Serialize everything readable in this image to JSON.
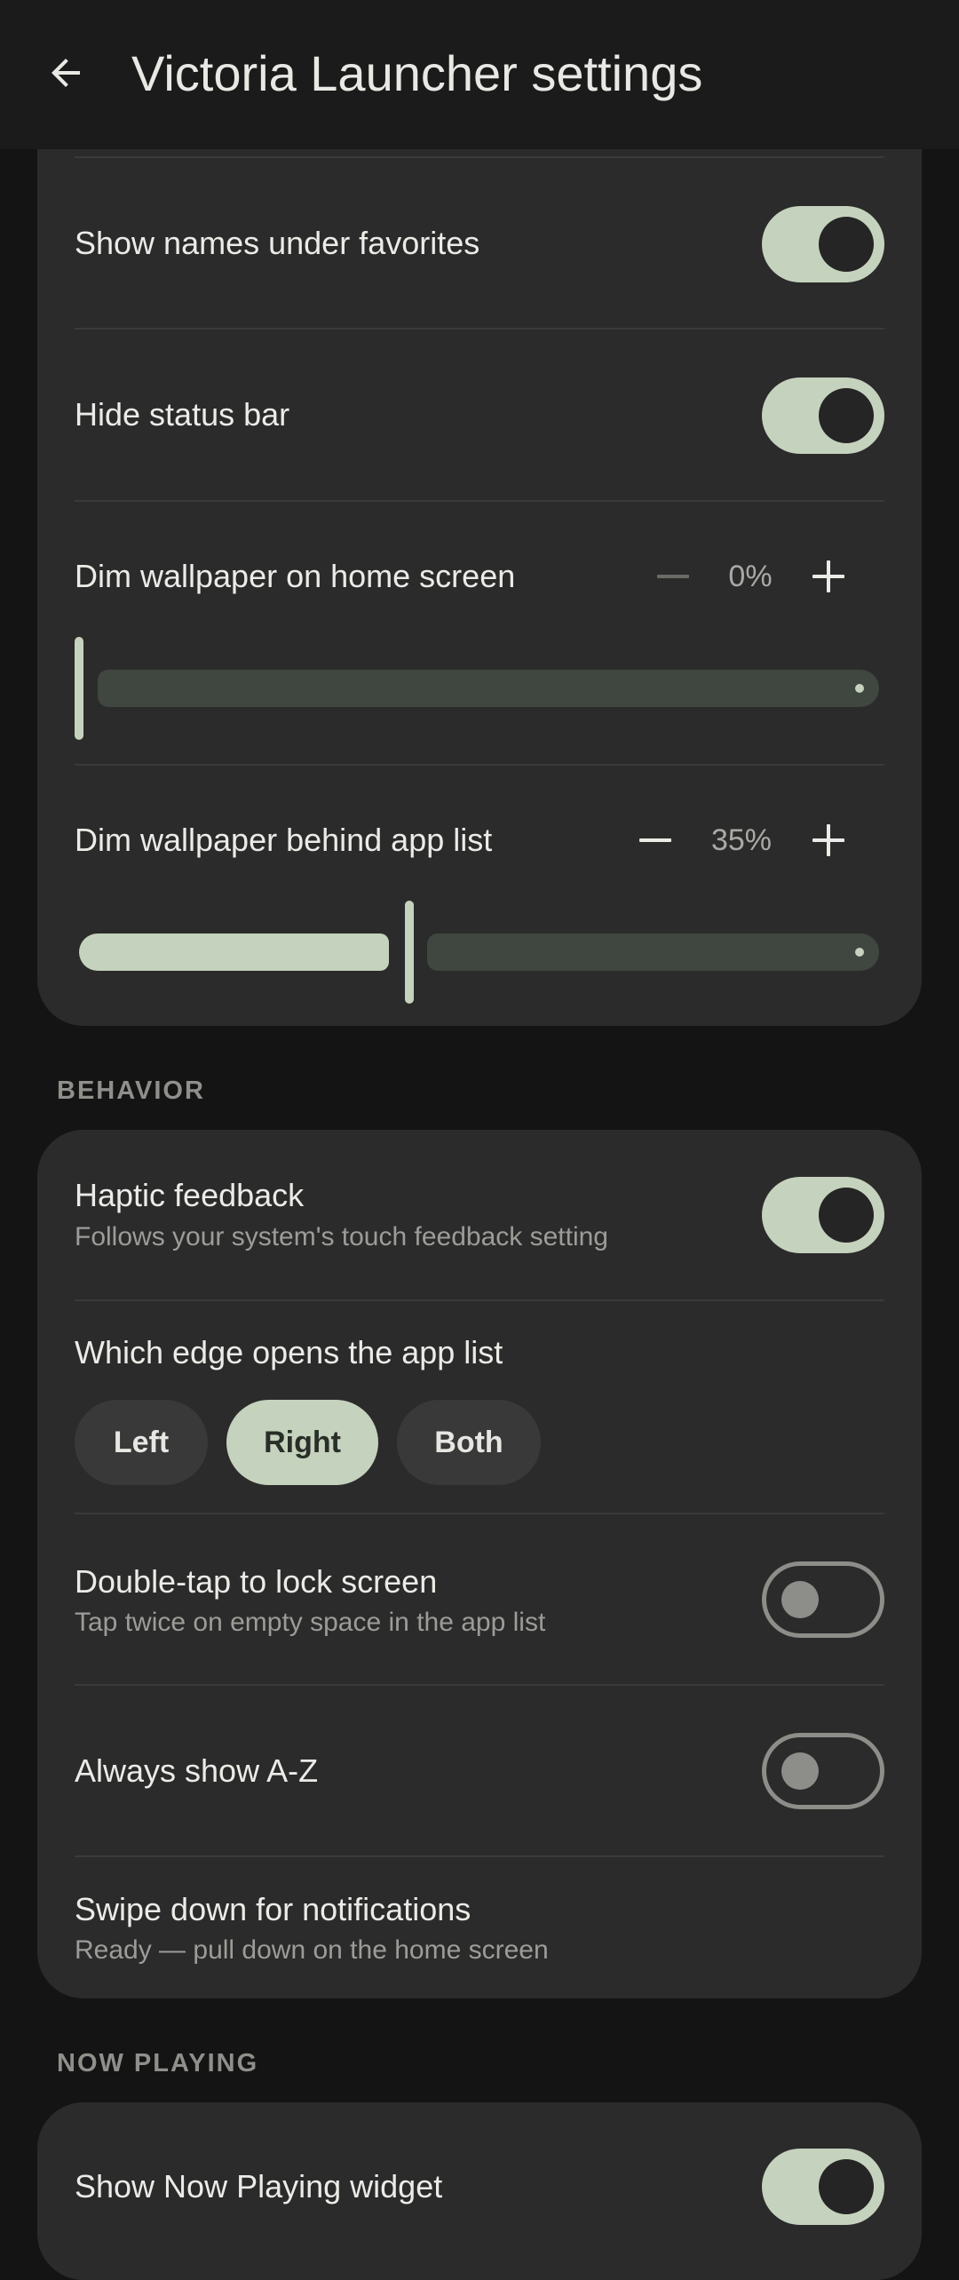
{
  "app_bar": {
    "title": "Victoria Launcher settings",
    "back_icon": "arrow-left-icon"
  },
  "appearance": {
    "show_names": {
      "label": "Show names under favorites",
      "enabled": true
    },
    "hide_status_bar": {
      "label": "Hide status bar",
      "enabled": true
    },
    "dim_home": {
      "label": "Dim wallpaper on home screen",
      "value_text": "0%",
      "value": 0
    },
    "dim_app_list": {
      "label": "Dim wallpaper behind app list",
      "value_text": "35%",
      "value": 35
    }
  },
  "behavior": {
    "header": "BEHAVIOR",
    "haptic": {
      "label": "Haptic feedback",
      "sub": "Follows your system's touch feedback setting",
      "enabled": true
    },
    "edge": {
      "label": "Which edge opens the app list",
      "options": [
        "Left",
        "Right",
        "Both"
      ],
      "selected": "Right"
    },
    "double_tap": {
      "label": "Double-tap to lock screen",
      "sub": "Tap twice on empty space in the app list",
      "enabled": false
    },
    "always_az": {
      "label": "Always show A-Z",
      "enabled": false
    },
    "swipe_down": {
      "label": "Swipe down for notifications",
      "sub": "Ready — pull down on the home screen"
    }
  },
  "now_playing": {
    "header": "NOW PLAYING",
    "widget": {
      "label": "Show Now Playing widget",
      "enabled": true
    }
  },
  "colors": {
    "accent": "#c5d2bd",
    "background": "#141414",
    "card": "#2b2b2b",
    "track_inactive": "#404640"
  }
}
